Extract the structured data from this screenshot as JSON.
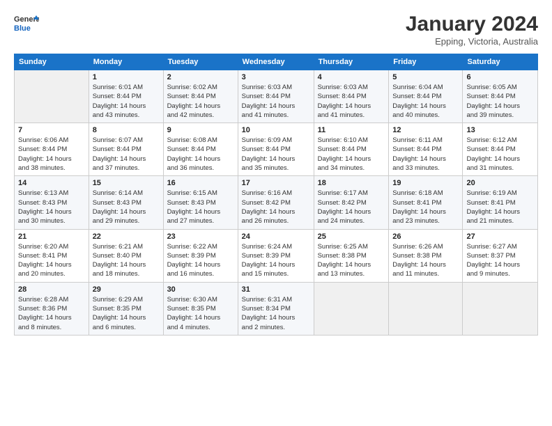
{
  "header": {
    "logo_line1": "General",
    "logo_line2": "Blue",
    "month_year": "January 2024",
    "location": "Epping, Victoria, Australia"
  },
  "weekdays": [
    "Sunday",
    "Monday",
    "Tuesday",
    "Wednesday",
    "Thursday",
    "Friday",
    "Saturday"
  ],
  "weeks": [
    [
      {
        "day": "",
        "info": ""
      },
      {
        "day": "1",
        "info": "Sunrise: 6:01 AM\nSunset: 8:44 PM\nDaylight: 14 hours\nand 43 minutes."
      },
      {
        "day": "2",
        "info": "Sunrise: 6:02 AM\nSunset: 8:44 PM\nDaylight: 14 hours\nand 42 minutes."
      },
      {
        "day": "3",
        "info": "Sunrise: 6:03 AM\nSunset: 8:44 PM\nDaylight: 14 hours\nand 41 minutes."
      },
      {
        "day": "4",
        "info": "Sunrise: 6:03 AM\nSunset: 8:44 PM\nDaylight: 14 hours\nand 41 minutes."
      },
      {
        "day": "5",
        "info": "Sunrise: 6:04 AM\nSunset: 8:44 PM\nDaylight: 14 hours\nand 40 minutes."
      },
      {
        "day": "6",
        "info": "Sunrise: 6:05 AM\nSunset: 8:44 PM\nDaylight: 14 hours\nand 39 minutes."
      }
    ],
    [
      {
        "day": "7",
        "info": "Sunrise: 6:06 AM\nSunset: 8:44 PM\nDaylight: 14 hours\nand 38 minutes."
      },
      {
        "day": "8",
        "info": "Sunrise: 6:07 AM\nSunset: 8:44 PM\nDaylight: 14 hours\nand 37 minutes."
      },
      {
        "day": "9",
        "info": "Sunrise: 6:08 AM\nSunset: 8:44 PM\nDaylight: 14 hours\nand 36 minutes."
      },
      {
        "day": "10",
        "info": "Sunrise: 6:09 AM\nSunset: 8:44 PM\nDaylight: 14 hours\nand 35 minutes."
      },
      {
        "day": "11",
        "info": "Sunrise: 6:10 AM\nSunset: 8:44 PM\nDaylight: 14 hours\nand 34 minutes."
      },
      {
        "day": "12",
        "info": "Sunrise: 6:11 AM\nSunset: 8:44 PM\nDaylight: 14 hours\nand 33 minutes."
      },
      {
        "day": "13",
        "info": "Sunrise: 6:12 AM\nSunset: 8:44 PM\nDaylight: 14 hours\nand 31 minutes."
      }
    ],
    [
      {
        "day": "14",
        "info": "Sunrise: 6:13 AM\nSunset: 8:43 PM\nDaylight: 14 hours\nand 30 minutes."
      },
      {
        "day": "15",
        "info": "Sunrise: 6:14 AM\nSunset: 8:43 PM\nDaylight: 14 hours\nand 29 minutes."
      },
      {
        "day": "16",
        "info": "Sunrise: 6:15 AM\nSunset: 8:43 PM\nDaylight: 14 hours\nand 27 minutes."
      },
      {
        "day": "17",
        "info": "Sunrise: 6:16 AM\nSunset: 8:42 PM\nDaylight: 14 hours\nand 26 minutes."
      },
      {
        "day": "18",
        "info": "Sunrise: 6:17 AM\nSunset: 8:42 PM\nDaylight: 14 hours\nand 24 minutes."
      },
      {
        "day": "19",
        "info": "Sunrise: 6:18 AM\nSunset: 8:41 PM\nDaylight: 14 hours\nand 23 minutes."
      },
      {
        "day": "20",
        "info": "Sunrise: 6:19 AM\nSunset: 8:41 PM\nDaylight: 14 hours\nand 21 minutes."
      }
    ],
    [
      {
        "day": "21",
        "info": "Sunrise: 6:20 AM\nSunset: 8:41 PM\nDaylight: 14 hours\nand 20 minutes."
      },
      {
        "day": "22",
        "info": "Sunrise: 6:21 AM\nSunset: 8:40 PM\nDaylight: 14 hours\nand 18 minutes."
      },
      {
        "day": "23",
        "info": "Sunrise: 6:22 AM\nSunset: 8:39 PM\nDaylight: 14 hours\nand 16 minutes."
      },
      {
        "day": "24",
        "info": "Sunrise: 6:24 AM\nSunset: 8:39 PM\nDaylight: 14 hours\nand 15 minutes."
      },
      {
        "day": "25",
        "info": "Sunrise: 6:25 AM\nSunset: 8:38 PM\nDaylight: 14 hours\nand 13 minutes."
      },
      {
        "day": "26",
        "info": "Sunrise: 6:26 AM\nSunset: 8:38 PM\nDaylight: 14 hours\nand 11 minutes."
      },
      {
        "day": "27",
        "info": "Sunrise: 6:27 AM\nSunset: 8:37 PM\nDaylight: 14 hours\nand 9 minutes."
      }
    ],
    [
      {
        "day": "28",
        "info": "Sunrise: 6:28 AM\nSunset: 8:36 PM\nDaylight: 14 hours\nand 8 minutes."
      },
      {
        "day": "29",
        "info": "Sunrise: 6:29 AM\nSunset: 8:35 PM\nDaylight: 14 hours\nand 6 minutes."
      },
      {
        "day": "30",
        "info": "Sunrise: 6:30 AM\nSunset: 8:35 PM\nDaylight: 14 hours\nand 4 minutes."
      },
      {
        "day": "31",
        "info": "Sunrise: 6:31 AM\nSunset: 8:34 PM\nDaylight: 14 hours\nand 2 minutes."
      },
      {
        "day": "",
        "info": ""
      },
      {
        "day": "",
        "info": ""
      },
      {
        "day": "",
        "info": ""
      }
    ]
  ]
}
